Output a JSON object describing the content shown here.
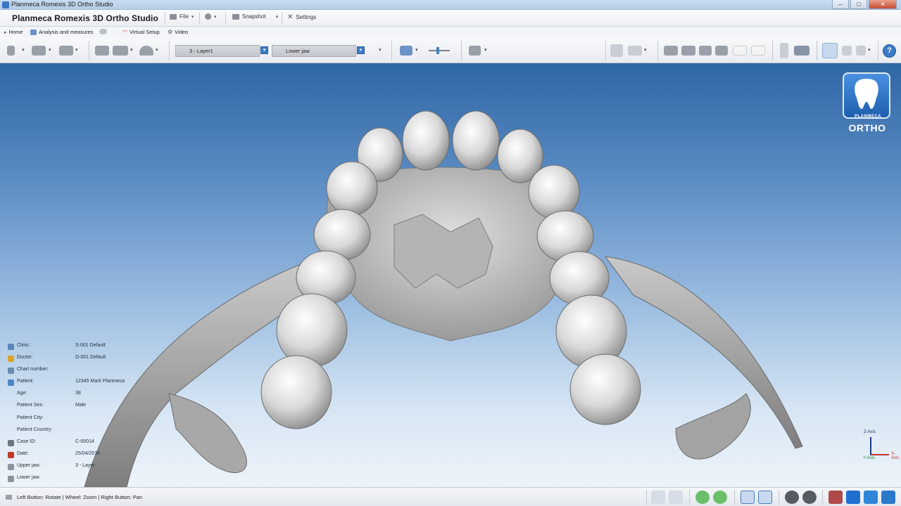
{
  "window": {
    "title": "Planmeca Romexis 3D Ortho Studio",
    "buttons": {
      "minimize": "–",
      "maximize": "□",
      "close": "✕"
    }
  },
  "appbar": {
    "title": "Planmeca Romexis 3D Ortho Studio",
    "file_label": "File",
    "snapshot_label": "Snapshot",
    "settings_label": "Settings"
  },
  "tabs": [
    {
      "label": "Home",
      "icon": "home-icon"
    },
    {
      "label": "Analysis and measures",
      "icon": "ruler-icon"
    },
    {
      "label": "",
      "icon": "cloud-icon"
    },
    {
      "label": "Virtual Setup",
      "icon": "arch-icon"
    },
    {
      "label": "Video",
      "icon": "film-icon"
    }
  ],
  "toolbar": {
    "layer_select": "3 - Layer1",
    "jaw_select": "Lower jaw",
    "dropdown_glyph": "▾"
  },
  "logo": {
    "brand": "PLANMECA",
    "product": "ORTHO",
    "accent": "#2f79d0"
  },
  "patient_info": [
    {
      "label": "Clinic:",
      "value": "S-001 Default",
      "icon": "building-icon",
      "icon_color": "#5b84b8"
    },
    {
      "label": "Doctor:",
      "value": "D-001 Default",
      "icon": "doctor-icon",
      "icon_color": "#d9a52b"
    },
    {
      "label": "Chart number:",
      "value": "",
      "icon": "chart-icon",
      "icon_color": "#6b8cb0"
    },
    {
      "label": "Patient:",
      "value": "12345 Mark Planmeca",
      "icon": "patient-icon",
      "icon_color": "#4f86c6"
    },
    {
      "label": "Age:",
      "value": "38",
      "icon": "",
      "icon_color": ""
    },
    {
      "label": "Patient Sex:",
      "value": "Male",
      "icon": "",
      "icon_color": ""
    },
    {
      "label": "Patient City:",
      "value": "",
      "icon": "",
      "icon_color": ""
    },
    {
      "label": "Patient Country:",
      "value": "",
      "icon": "",
      "icon_color": ""
    },
    {
      "label": "Case ID:",
      "value": "C-00014",
      "icon": "case-icon",
      "icon_color": "#6f7780"
    },
    {
      "label": "Date:",
      "value": "25/04/2016",
      "icon": "calendar-icon",
      "icon_color": "#c0392b"
    },
    {
      "label": "Upper jaw:",
      "value": "3 - Layer",
      "icon": "upper-jaw-icon",
      "icon_color": "#8b949e"
    },
    {
      "label": "Lower jaw:",
      "value": "",
      "icon": "lower-jaw-icon",
      "icon_color": "#8b949e"
    }
  ],
  "axis": {
    "z_label": "Z-Axis",
    "x_label": "X-Axis",
    "y_label": "Y-Axis"
  },
  "statusbar": {
    "hint": "Left Button: Rotate | Wheel: Zoom | Right Button: Pan"
  },
  "colors": {
    "viewport_top": "#2f66a6",
    "viewport_bottom": "#eef4fa",
    "tooth": "#e2e2e2",
    "bone": "#9e9e9e"
  }
}
